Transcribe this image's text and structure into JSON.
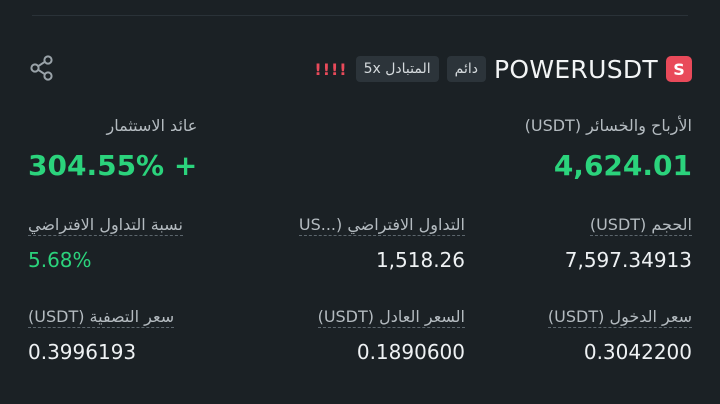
{
  "position": {
    "symbol": "POWERUSDT",
    "side_badge": "S",
    "type_chip": "دائم",
    "leverage_chip": "المتبادل 5x",
    "warning": "!!!!"
  },
  "colors": {
    "background": "#1b2125",
    "green": "#2bd37c",
    "red": "#e94a5a"
  },
  "icons": {
    "share": "share-icon"
  },
  "stats": {
    "pnl_label": "الأرباح والخسائر (USDT)",
    "pnl_value": "4,624.01",
    "roi_label": "عائد الاستثمار",
    "roi_value": "+ 304.55%",
    "size_label": "الحجم (USDT)",
    "size_value": "7,597.34913",
    "virtual_trade_label": "التداول الافتراضي (...US",
    "virtual_trade_value": "1,518.26",
    "virtual_ratio_label": "نسبة التداول الافتراضي",
    "virtual_ratio_value": "5.68%",
    "entry_label": "سعر الدخول (USDT)",
    "entry_value": "0.3042200",
    "fair_label": "السعر العادل (USDT)",
    "fair_value": "0.1890600",
    "liq_label": "سعر التصفية (USDT)",
    "liq_value": "0.3996193"
  }
}
